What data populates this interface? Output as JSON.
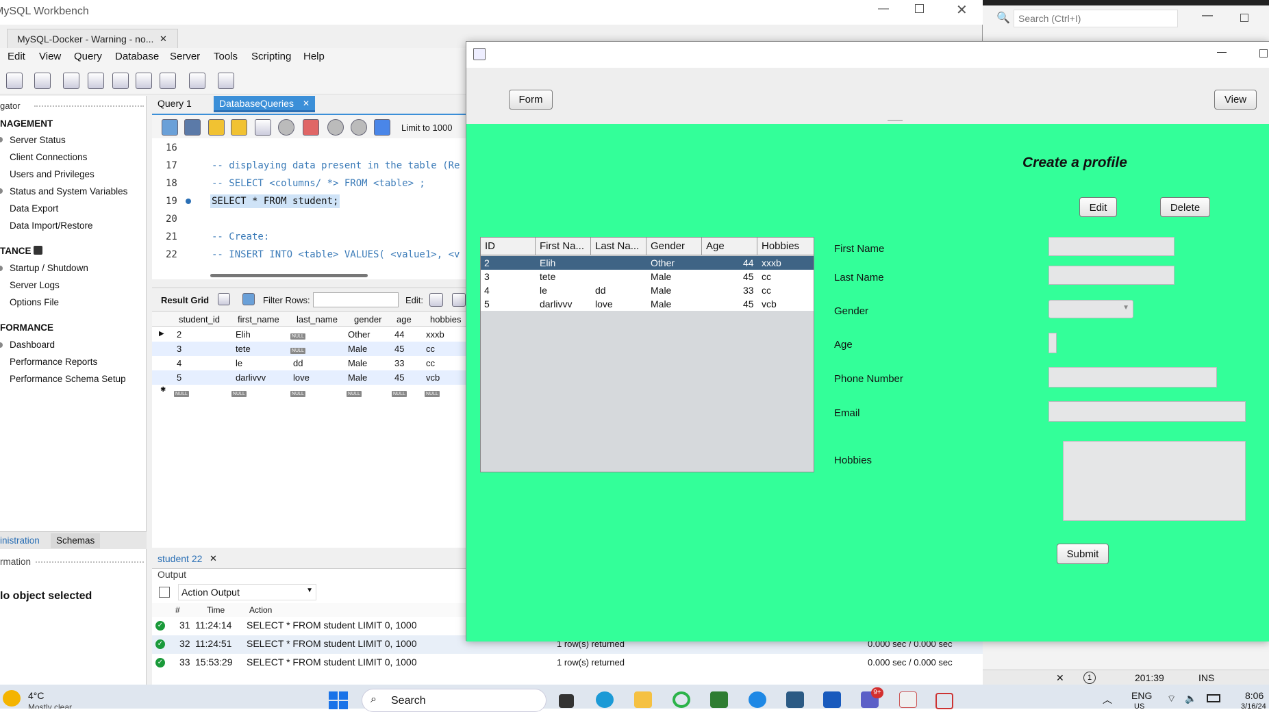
{
  "wb": {
    "title": "MySQL Workbench",
    "conn_tab": "MySQL-Docker - Warning - no...",
    "menu": [
      "Edit",
      "View",
      "Query",
      "Database",
      "Server",
      "Tools",
      "Scripting",
      "Help"
    ],
    "nav_header": "gator",
    "sections": [
      {
        "title": "NAGEMENT",
        "items": [
          "Server Status",
          "Client Connections",
          "Users and Privileges",
          "Status and System Variables",
          "Data Export",
          "Data Import/Restore"
        ]
      },
      {
        "title": "TANCE",
        "items": [
          "Startup / Shutdown",
          "Server Logs",
          "Options File"
        ]
      },
      {
        "title": "FORMANCE",
        "items": [
          "Dashboard",
          "Performance Reports",
          "Performance Schema Setup"
        ]
      }
    ],
    "nav_tabs": [
      "inistration",
      "Schemas"
    ],
    "info_label": "rmation",
    "no_object": "lo object selected",
    "query_tabs": [
      "Query 1",
      "DatabaseQueries"
    ],
    "limit": "Limit to 1000",
    "lines": [
      {
        "n": "16",
        "text": ""
      },
      {
        "n": "17",
        "text": "-- displaying data present in the table (Re"
      },
      {
        "n": "18",
        "text": "-- SELECT <columns/ *> FROM <table> ;"
      },
      {
        "n": "19",
        "text": "SELECT * FROM student;"
      },
      {
        "n": "20",
        "text": ""
      },
      {
        "n": "21",
        "text": "-- Create:"
      },
      {
        "n": "22",
        "text": "-- INSERT INTO <table> VALUES( <value1>, <v"
      }
    ],
    "result_grid_label": "Result Grid",
    "filter_rows": "Filter Rows:",
    "edit_label": "Edit:",
    "grid_headers": [
      "student_id",
      "first_name",
      "last_name",
      "gender",
      "age",
      "hobbies"
    ],
    "grid_rows": [
      [
        "2",
        "Elih",
        "NULL",
        "Other",
        "44",
        "xxxb"
      ],
      [
        "3",
        "tete",
        "NULL",
        "Male",
        "45",
        "cc"
      ],
      [
        "4",
        "le",
        "dd",
        "Male",
        "33",
        "cc"
      ],
      [
        "5",
        "darlivvv",
        "love",
        "Male",
        "45",
        "vcb"
      ]
    ],
    "null_label": "NULL",
    "result_tab": "student 22",
    "output_label": "Output",
    "action_output": "Action Output",
    "out_headers": [
      "#",
      "Time",
      "Action"
    ],
    "out_rows": [
      {
        "n": "31",
        "time": "11:24:14",
        "action": "SELECT * FROM student LIMIT 0, 1000",
        "msg": "",
        "dur": ""
      },
      {
        "n": "32",
        "time": "11:24:51",
        "action": "SELECT * FROM student LIMIT 0, 1000",
        "msg": "1 row(s) returned",
        "dur": "0.000 sec / 0.000 sec"
      },
      {
        "n": "33",
        "time": "15:53:29",
        "action": "SELECT * FROM student LIMIT 0, 1000",
        "msg": "1 row(s) returned",
        "dur": "0.000 sec / 0.000 sec"
      }
    ]
  },
  "right_bg": {
    "search_placeholder": "Search (Ctrl+I)",
    "status_pos": "201:39",
    "status_mode": "INS",
    "status_circle": "1"
  },
  "app": {
    "form_btn": "Form",
    "view_btn": "View",
    "heading": "Create  a profile",
    "edit_btn": "Edit",
    "delete_btn": "Delete",
    "table_headers": [
      "ID",
      "First Na...",
      "Last Na...",
      "Gender",
      "Age",
      "Hobbies"
    ],
    "table_rows": [
      [
        "2",
        "Elih",
        "",
        "Other",
        "44",
        "xxxb"
      ],
      [
        "3",
        "tete",
        "",
        "Male",
        "45",
        "cc"
      ],
      [
        "4",
        "le",
        "dd",
        "Male",
        "33",
        "cc"
      ],
      [
        "5",
        "darlivvv",
        "love",
        "Male",
        "45",
        "vcb"
      ]
    ],
    "labels": {
      "first_name": "First Name",
      "last_name": "Last Name",
      "gender": "Gender",
      "age": "Age",
      "phone": "Phone Number",
      "email": "Email",
      "hobbies": "Hobbies"
    },
    "submit_btn": "Submit",
    "green": "#33ff99"
  },
  "taskbar": {
    "weather_temp": "4°C",
    "weather_desc": "Mostly clear",
    "search": "Search",
    "lang": "ENG",
    "lang2": "US",
    "time": "8:06",
    "date": "3/16/24",
    "badge": "9+"
  }
}
